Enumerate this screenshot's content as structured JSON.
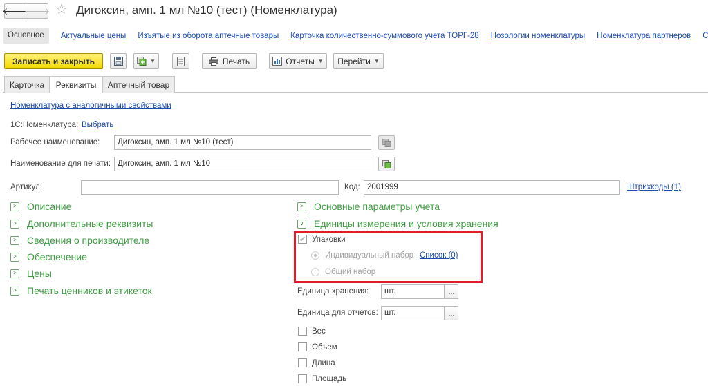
{
  "window": {
    "title": "Дигоксин, амп. 1 мл №10 (тест) (Номенклатура)"
  },
  "sections": [
    {
      "label": "Основное",
      "active": true
    },
    {
      "label": "Актуальные цены",
      "active": false
    },
    {
      "label": "Изъятые из оборота аптечные товары",
      "active": false
    },
    {
      "label": "Карточка количественно-суммового учета ТОРГ-28",
      "active": false
    },
    {
      "label": "Нозологии номенклатуры",
      "active": false
    },
    {
      "label": "Номенклатура партнеров",
      "active": false
    }
  ],
  "toolbar": {
    "save_close": "Записать и закрыть",
    "print": "Печать",
    "reports": "Отчеты",
    "goto": "Перейти"
  },
  "tabs": [
    {
      "label": "Карточка",
      "active": false
    },
    {
      "label": "Реквизиты",
      "active": true
    },
    {
      "label": "Аптечный товар",
      "active": false
    }
  ],
  "form": {
    "similar_link": "Номенклатура с аналогичными свойствами",
    "nom_1c_label": "1С:Номенклатура:",
    "nom_1c_link": "Выбрать",
    "work_name_label": "Рабочее наименование:",
    "work_name_value": "Дигоксин, амп. 1 мл №10 (тест)",
    "print_name_label": "Наименование для печати:",
    "print_name_value": "Дигоксин, амп. 1 мл №10",
    "article_label": "Артикул:",
    "article_value": "",
    "code_label": "Код:",
    "code_value": "2001999",
    "barcodes_link": "Штрихкоды (1)"
  },
  "groups_left": [
    "Описание",
    "Дополнительные реквизиты",
    "Сведения о производителе",
    "Обеспечение",
    "Цены",
    "Печать ценников и этикеток"
  ],
  "groups_right": [
    {
      "label": "Основные параметры учета",
      "expanded": false
    },
    {
      "label": "Единицы измерения и условия хранения",
      "expanded": true
    }
  ],
  "units": {
    "packages_label": "Упаковки",
    "packages_checked": true,
    "individual_set": "Индивидуальный набор",
    "list_link": "Список (0)",
    "common_set": "Общий набор",
    "storage_unit_label": "Единица хранения:",
    "storage_unit_value": "шт.",
    "report_unit_label": "Единица для отчетов:",
    "report_unit_value": "шт.",
    "measures": [
      "Вес",
      "Объем",
      "Длина",
      "Площадь"
    ]
  },
  "colors": {
    "primary_button": "#f4d900",
    "group_header": "#3c9e40",
    "link": "#1c4cb0",
    "highlight_frame": "#e01d2a"
  }
}
